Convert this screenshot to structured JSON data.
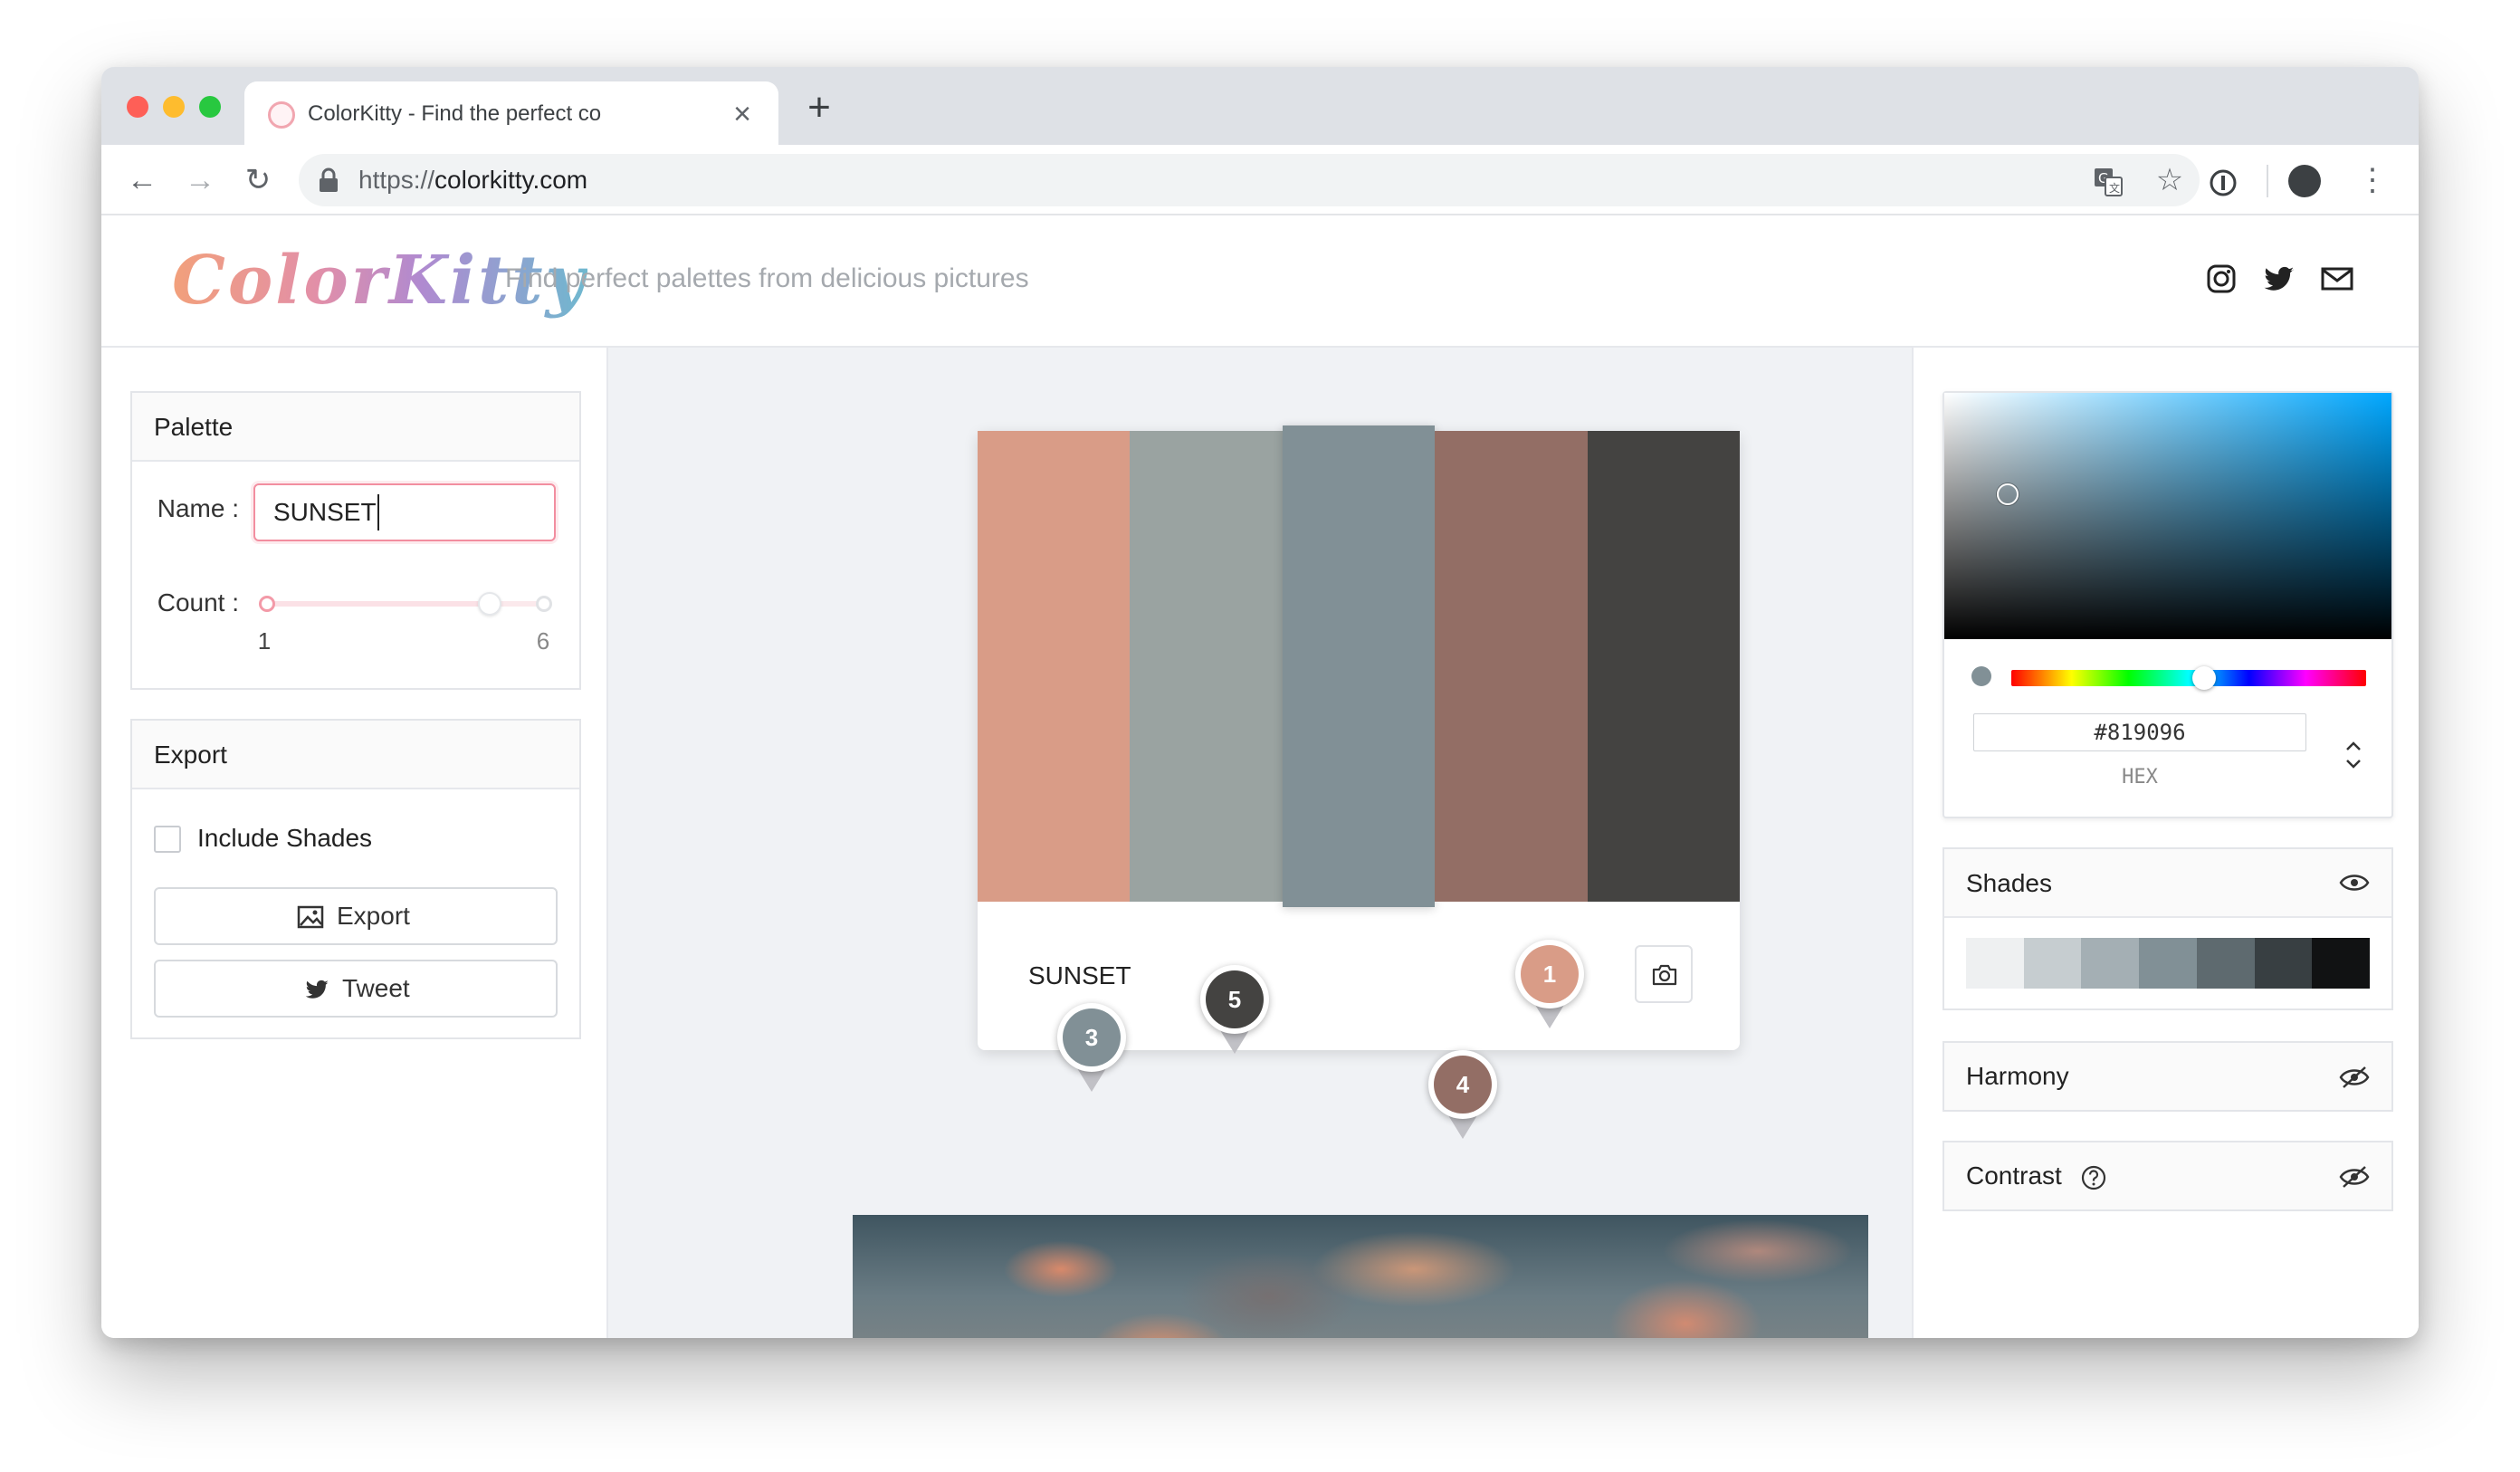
{
  "browser": {
    "tab_title": "ColorKitty - Find the perfect co",
    "tab_close": "×",
    "new_tab": "+",
    "url_scheme": "https://",
    "url_host": "colorkitty.com",
    "nav": {
      "back": "←",
      "forward": "→",
      "reload": "↻",
      "star": "☆",
      "menu": "⋮"
    }
  },
  "header": {
    "logo": "ColorKitty",
    "tagline": "Find perfect palettes from delicious pictures"
  },
  "palette_panel": {
    "title": "Palette",
    "name_label": "Name :",
    "name_value": "SUNSET",
    "count_label": "Count :",
    "count_min": "1",
    "count_max": "6",
    "count_value": 5
  },
  "export_panel": {
    "title": "Export",
    "include_shades_label": "Include Shades",
    "include_shades_checked": false,
    "export_button": "Export",
    "tweet_button": "Tweet"
  },
  "palette": {
    "name": "SUNSET",
    "colors": [
      "#d99c87",
      "#9aa3a1",
      "#819096",
      "#936e65",
      "#444341"
    ],
    "selected_index": 2
  },
  "pins": [
    {
      "label": "3",
      "color": "#819096"
    },
    {
      "label": "5",
      "color": "#444341"
    },
    {
      "label": "1",
      "color": "#d99c87"
    },
    {
      "label": "4",
      "color": "#936e65"
    }
  ],
  "picker": {
    "hex_value": "#819096",
    "hex_label": "HEX",
    "current_color": "#819096"
  },
  "shades_panel": {
    "title": "Shades",
    "colors": [
      "#eef0f1",
      "#c6cdd0",
      "#a4afb4",
      "#819096",
      "#5e6a6f",
      "#383f42",
      "#111213"
    ]
  },
  "harmony_panel": {
    "title": "Harmony"
  },
  "contrast_panel": {
    "title": "Contrast"
  }
}
